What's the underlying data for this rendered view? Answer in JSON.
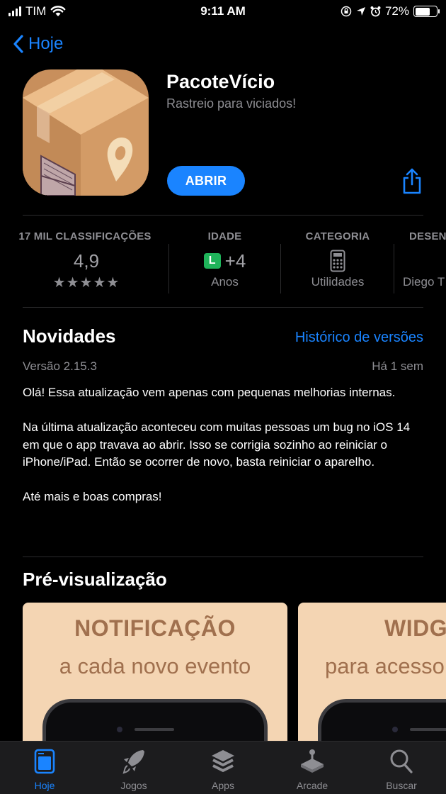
{
  "status_bar": {
    "carrier": "TIM",
    "time": "9:11 AM",
    "battery": "72%",
    "battery_level": 0.72,
    "icons": [
      "signal-icon",
      "wifi-icon",
      "orientation-lock-icon",
      "location-icon",
      "alarm-icon",
      "battery-icon"
    ]
  },
  "nav": {
    "back_label": "Hoje"
  },
  "app": {
    "name": "PacoteVício",
    "subtitle": "Rastreio para viciados!",
    "open_label": "ABRIR",
    "accent": "#1a84ff"
  },
  "info": {
    "ratings": {
      "label": "17 MIL CLASSIFICAÇÕES",
      "value": "4,9",
      "stars": "★★★★★",
      "rating": 4.9,
      "max": 5
    },
    "age": {
      "label": "IDADE",
      "badge": "L",
      "value": "+4",
      "sub": "Anos"
    },
    "category": {
      "label": "CATEGORIA",
      "sub": "Utilidades"
    },
    "developer": {
      "label": "DESENVOLVEDOR",
      "sub": "Diego T"
    }
  },
  "whats_new": {
    "title": "Novidades",
    "history_link": "Histórico de versões",
    "version": "Versão 2.15.3",
    "ago": "Há 1 sem",
    "paragraphs": [
      "Olá! Essa atualização vem apenas com pequenas melhorias internas.",
      "Na última atualização aconteceu com muitas pessoas um bug no iOS 14 em que o app travava ao abrir. Isso se corrigia sozinho ao reiniciar o iPhone/iPad. Então se ocorrer de novo, basta reiniciar o aparelho.",
      "Até mais e boas compras!"
    ]
  },
  "preview": {
    "title": "Pré-visualização",
    "cards": [
      {
        "title": "NOTIFICAÇÃO",
        "subtitle": "a cada novo evento"
      },
      {
        "title": "WIDGET",
        "subtitle": "para acesso"
      }
    ]
  },
  "tab_bar": {
    "tabs": [
      {
        "label": "Hoje",
        "icon": "today-icon",
        "active": true
      },
      {
        "label": "Jogos",
        "icon": "rocket-icon",
        "active": false
      },
      {
        "label": "Apps",
        "icon": "stack-icon",
        "active": false
      },
      {
        "label": "Arcade",
        "icon": "joystick-icon",
        "active": false
      },
      {
        "label": "Buscar",
        "icon": "search-icon",
        "active": false
      }
    ]
  }
}
